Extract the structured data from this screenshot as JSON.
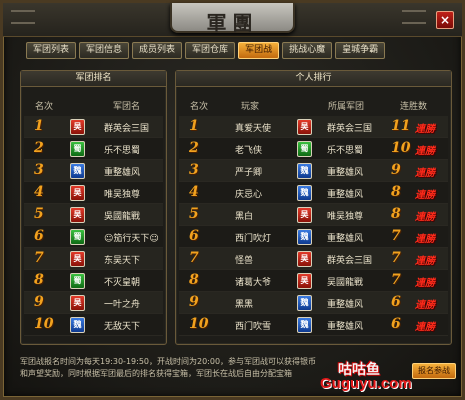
{
  "window": {
    "title": "軍團",
    "close_label": "×"
  },
  "tabs": [
    {
      "label": "军团列表",
      "active": false
    },
    {
      "label": "军团信息",
      "active": false
    },
    {
      "label": "成员列表",
      "active": false
    },
    {
      "label": "军团仓库",
      "active": false
    },
    {
      "label": "军团战",
      "active": true
    },
    {
      "label": "挑战心魔",
      "active": false
    },
    {
      "label": "皇城争霸",
      "active": false
    }
  ],
  "legion_ranking": {
    "title": "军团排名",
    "col_rank": "名次",
    "col_name": "军团名",
    "rows": [
      {
        "rank": "1",
        "faction": "吴",
        "faction_icon": "wu-faction-icon",
        "name": "群英会三国"
      },
      {
        "rank": "2",
        "faction": "蜀",
        "faction_icon": "shu-faction-icon",
        "name": "乐不思蜀"
      },
      {
        "rank": "3",
        "faction": "魏",
        "faction_icon": "wei-faction-icon",
        "name": "重整雄风"
      },
      {
        "rank": "4",
        "faction": "吴",
        "faction_icon": "wu-faction-icon",
        "name": "唯吴独尊"
      },
      {
        "rank": "5",
        "faction": "吴",
        "faction_icon": "wu-faction-icon",
        "name": "吳國龍戰"
      },
      {
        "rank": "6",
        "faction": "蜀",
        "faction_icon": "shu-faction-icon",
        "name": "☺笳行天下☺"
      },
      {
        "rank": "7",
        "faction": "吴",
        "faction_icon": "wu-faction-icon",
        "name": "东吴天下"
      },
      {
        "rank": "8",
        "faction": "蜀",
        "faction_icon": "shu-faction-icon",
        "name": "不灭皇朝"
      },
      {
        "rank": "9",
        "faction": "吴",
        "faction_icon": "wu-faction-icon",
        "name": "一叶之舟"
      },
      {
        "rank": "10",
        "faction": "魏",
        "faction_icon": "wei-faction-icon",
        "name": "无敌天下"
      }
    ]
  },
  "personal_ranking": {
    "title": "个人排行",
    "col_rank": "名次",
    "col_player": "玩家",
    "col_legion": "所属军团",
    "col_streak": "连胜数",
    "streak_suffix": "連勝",
    "rows": [
      {
        "rank": "1",
        "player": "真爱天使",
        "faction": "吴",
        "legion": "群英会三国",
        "streak": "11"
      },
      {
        "rank": "2",
        "player": "老飞侠",
        "faction": "蜀",
        "legion": "乐不思蜀",
        "streak": "10"
      },
      {
        "rank": "3",
        "player": "严子卿",
        "faction": "魏",
        "legion": "重整雄风",
        "streak": "9"
      },
      {
        "rank": "4",
        "player": "庆忌心",
        "faction": "魏",
        "legion": "重整雄风",
        "streak": "8"
      },
      {
        "rank": "5",
        "player": "黑白",
        "faction": "吴",
        "legion": "唯吴独尊",
        "streak": "8"
      },
      {
        "rank": "6",
        "player": "西门吹灯",
        "faction": "魏",
        "legion": "重整雄风",
        "streak": "7"
      },
      {
        "rank": "7",
        "player": "怪兽",
        "faction": "吴",
        "legion": "群英会三国",
        "streak": "7"
      },
      {
        "rank": "8",
        "player": "诸葛大爷",
        "faction": "吴",
        "legion": "吴國龍戰",
        "streak": "7"
      },
      {
        "rank": "9",
        "player": "黑黑",
        "faction": "魏",
        "legion": "重整雄风",
        "streak": "6"
      },
      {
        "rank": "10",
        "player": "西门吹雪",
        "faction": "魏",
        "legion": "重整雄风",
        "streak": "6"
      }
    ]
  },
  "footer": {
    "line1": "军团战报名时间为每天19:30-19:50，开战时间为20:00，参与军团战可以获得银币",
    "line2": "和声望奖励，同时根据军团最后的排名获得宝箱，军团长在战后自由分配宝箱"
  },
  "watermark": {
    "cn": "咕咕鱼",
    "en": "Guguyu.com",
    "button": "报名参战"
  },
  "colors": {
    "accent": "#f2a21e",
    "streak_red": "#ff2a1a",
    "wu": "#c21a10",
    "shu": "#1c8a22",
    "wei": "#1e5ab8"
  }
}
